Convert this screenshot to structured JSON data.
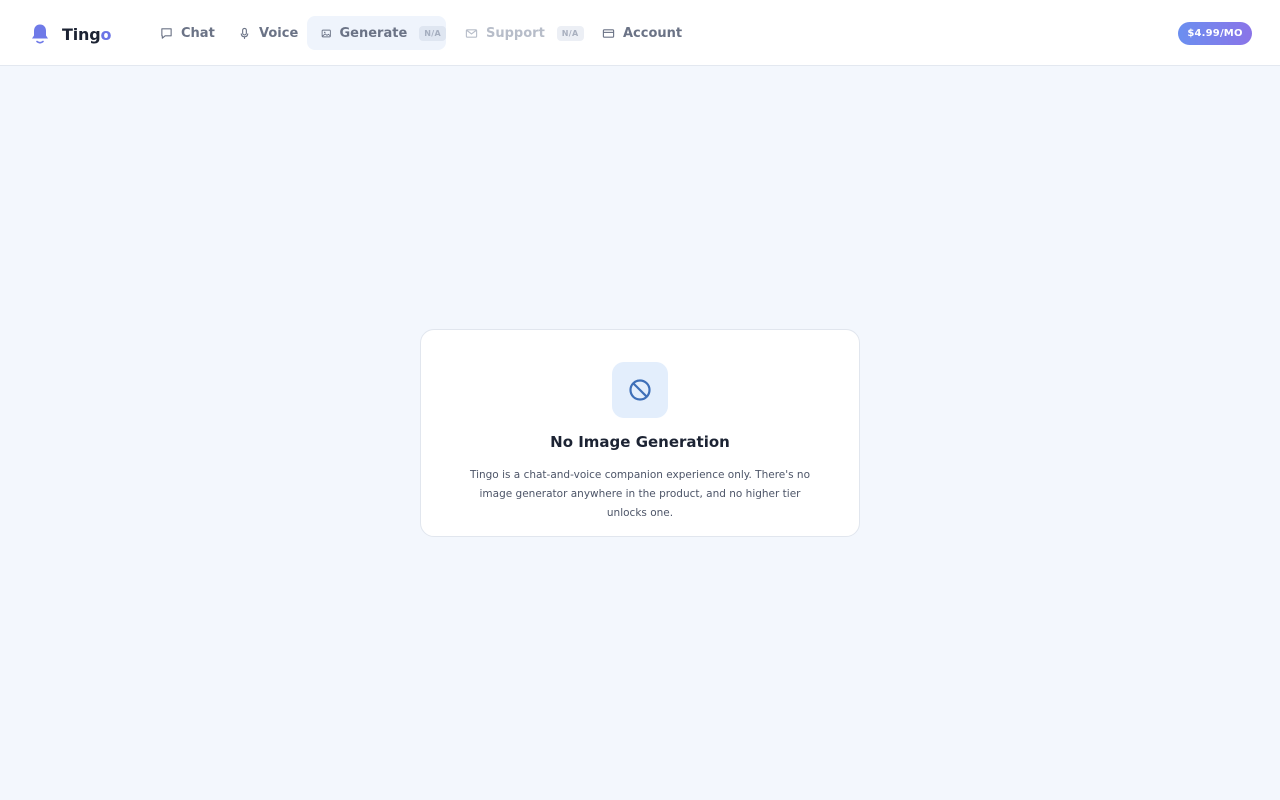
{
  "brand": {
    "name_main": "Ting",
    "name_accent": "o",
    "icon": "bell-icon",
    "accent_color": "#6b74e6"
  },
  "nav": {
    "chat": {
      "label": "Chat",
      "icon": "chat-bubble-icon"
    },
    "voice": {
      "label": "Voice",
      "icon": "microphone-icon"
    },
    "generate": {
      "label": "Generate",
      "badge": "N/A",
      "icon": "image-icon",
      "active": true
    },
    "support": {
      "label": "Support",
      "badge": "N/A",
      "icon": "mail-icon",
      "disabled": true
    },
    "account": {
      "label": "Account",
      "icon": "credit-card-icon"
    }
  },
  "pricing": {
    "label": "$4.99/MO"
  },
  "notice": {
    "icon": "prohibited-icon",
    "title": "No Image Generation",
    "description": "Tingo is a chat-and-voice companion experience only. There's no image generator anywhere in the product, and no higher tier unlocks one."
  },
  "colors": {
    "background": "#f3f7fd",
    "pill_gradient_start": "#6b8ff0",
    "pill_gradient_end": "#8a74e8",
    "icon_blue": "#3e6fb8"
  }
}
